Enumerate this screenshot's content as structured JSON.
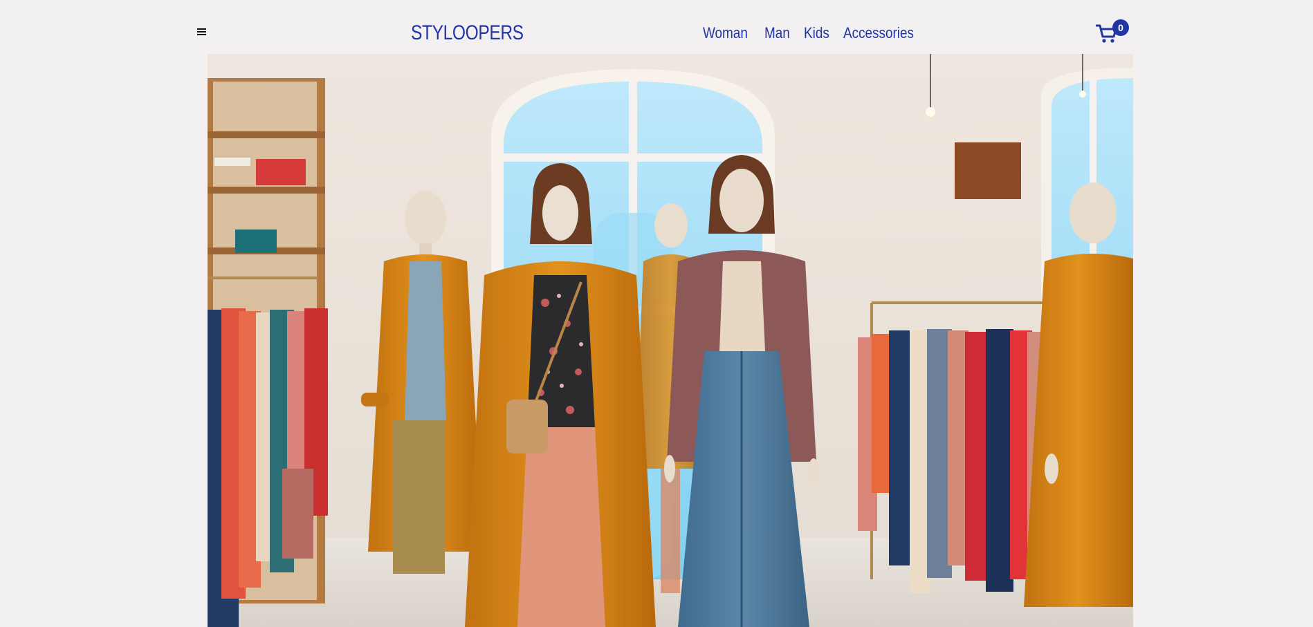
{
  "header": {
    "brand": "STYLOOPERS",
    "nav": [
      {
        "label": "Woman"
      },
      {
        "label": "Man"
      },
      {
        "label": "Kids"
      },
      {
        "label": "Accessories"
      }
    ],
    "cart_count": "0"
  },
  "hero": {
    "image": "clothing-store-mannequins-photo"
  },
  "colors": {
    "brand": "#2235a5",
    "background": "#f2f0f0"
  }
}
